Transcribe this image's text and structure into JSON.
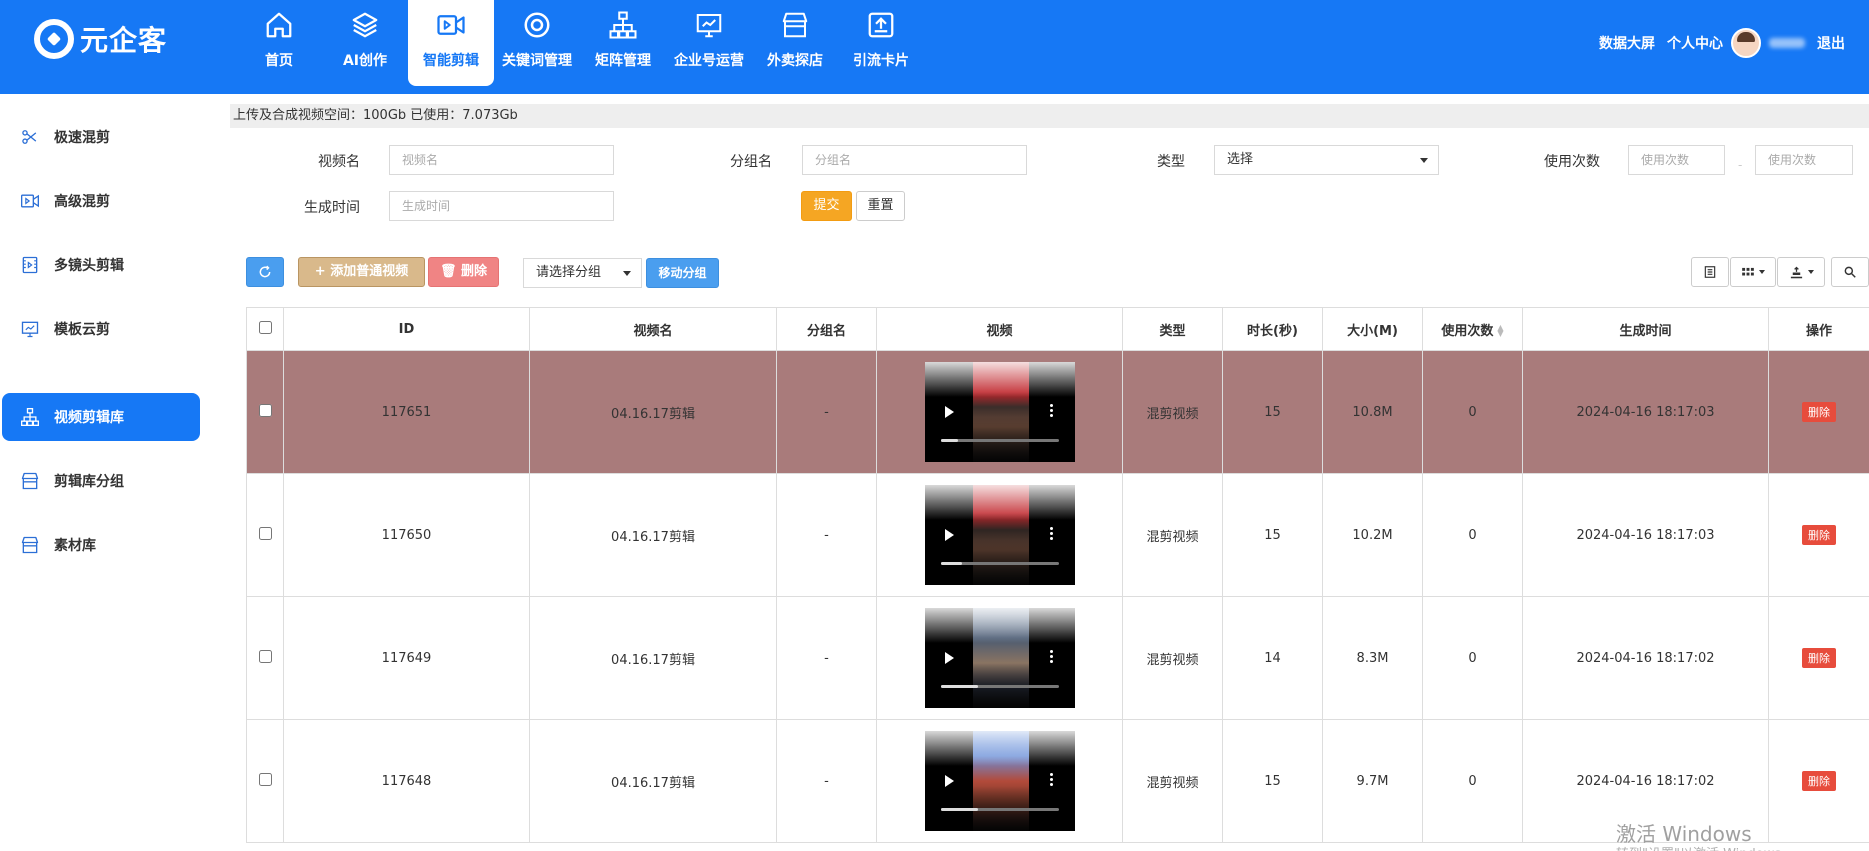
{
  "header": {
    "logo_text": "元企客",
    "nav": [
      {
        "label": "首页",
        "icon": "home-icon",
        "active": false
      },
      {
        "label": "AI创作",
        "icon": "layers-icon",
        "active": false
      },
      {
        "label": "智能剪辑",
        "icon": "video-camera-icon",
        "active": true
      },
      {
        "label": "关键词管理",
        "icon": "target-icon",
        "active": false
      },
      {
        "label": "矩阵管理",
        "icon": "hierarchy-icon",
        "active": false
      },
      {
        "label": "企业号运营",
        "icon": "presentation-icon",
        "active": false
      },
      {
        "label": "外卖探店",
        "icon": "store-icon",
        "active": false
      },
      {
        "label": "引流卡片",
        "icon": "upload-box-icon",
        "active": false
      }
    ],
    "data_screen": "数据大屏",
    "personal_center": "个人中心",
    "logout": "退出"
  },
  "sidebar": {
    "items": [
      {
        "label": "极速混剪",
        "icon": "scissors-icon",
        "active": false
      },
      {
        "label": "高级混剪",
        "icon": "video-play-icon",
        "active": false
      },
      {
        "label": "多镜头剪辑",
        "icon": "film-icon",
        "active": false
      },
      {
        "label": "模板云剪",
        "icon": "presentation-icon",
        "active": false
      },
      {
        "label": "视频剪辑库",
        "icon": "hierarchy-icon",
        "active": true
      },
      {
        "label": "剪辑库分组",
        "icon": "store-icon",
        "active": false
      },
      {
        "label": "素材库",
        "icon": "store-icon",
        "active": false
      }
    ]
  },
  "quota": {
    "text": "上传及合成视频空间：100Gb 已使用：7.073Gb"
  },
  "filters": {
    "video_name_label": "视频名",
    "video_name_placeholder": "视频名",
    "group_name_label": "分组名",
    "group_name_placeholder": "分组名",
    "type_label": "类型",
    "type_value": "选择",
    "use_count_label": "使用次数",
    "use_count_min_placeholder": "使用次数",
    "use_count_max_placeholder": "使用次数",
    "created_time_label": "生成时间",
    "created_time_placeholder": "生成时间",
    "submit": "提交",
    "reset": "重置"
  },
  "toolbar": {
    "refresh_icon": "refresh-icon",
    "add_video": "+ 添加普通视频",
    "delete": "🗑 删除",
    "group_select": "请选择分组",
    "move_group": "移动分组"
  },
  "table": {
    "headers": [
      "ID",
      "视频名",
      "分组名",
      "视频",
      "类型",
      "时长(秒)",
      "大小(M)",
      "使用次数",
      "生成时间",
      "操作"
    ],
    "delete_label": "删除",
    "rows": [
      {
        "id": "117651",
        "name": "04.16.17剪辑",
        "group": "-",
        "type": "混剪视频",
        "duration": "15",
        "size": "10.8M",
        "uses": "0",
        "created": "2024-04-16 18:17:03",
        "selected": true,
        "progress": 0.15
      },
      {
        "id": "117650",
        "name": "04.16.17剪辑",
        "group": "-",
        "type": "混剪视频",
        "duration": "15",
        "size": "10.2M",
        "uses": "0",
        "created": "2024-04-16 18:17:03",
        "selected": false,
        "progress": 0.18
      },
      {
        "id": "117649",
        "name": "04.16.17剪辑",
        "group": "-",
        "type": "混剪视频",
        "duration": "14",
        "size": "8.3M",
        "uses": "0",
        "created": "2024-04-16 18:17:02",
        "selected": false,
        "progress": 0.32
      },
      {
        "id": "117648",
        "name": "04.16.17剪辑",
        "group": "-",
        "type": "混剪视频",
        "duration": "15",
        "size": "9.7M",
        "uses": "0",
        "created": "2024-04-16 18:17:02",
        "selected": false,
        "progress": 0.32
      }
    ]
  },
  "watermark": {
    "title": "激活 Windows",
    "subtitle": "转到\"设置\"以激活 Windows。"
  },
  "colors": {
    "primary": "#1678f5",
    "selected_row": "#a97b7b",
    "submit": "#f5a623",
    "danger": "#e74c3c"
  }
}
